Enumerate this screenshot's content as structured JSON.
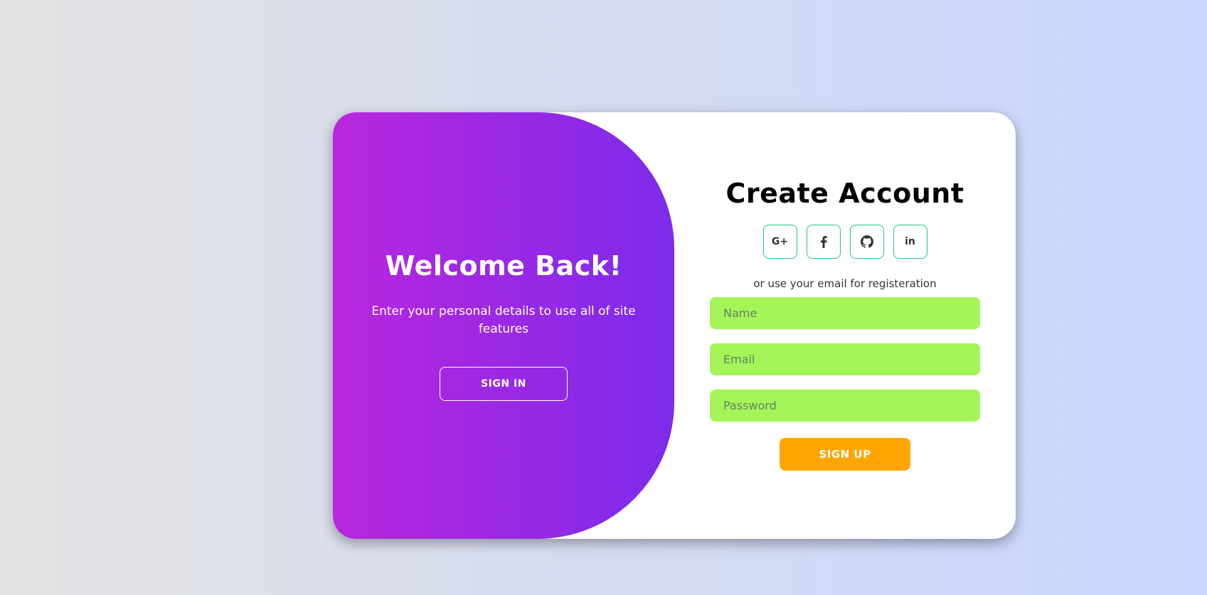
{
  "toggle": {
    "title": "Welcome Back!",
    "text": "Enter your personal details to use all of site features",
    "button_label": "SIGN IN"
  },
  "signup": {
    "title": "Create Account",
    "social": [
      {
        "icon": "google-plus-icon",
        "label": "G+"
      },
      {
        "icon": "facebook-icon",
        "label": "f"
      },
      {
        "icon": "github-icon",
        "label": ""
      },
      {
        "icon": "linkedin-icon",
        "label": "in"
      }
    ],
    "alt_text": "or use your email for registeration",
    "fields": {
      "name_placeholder": "Name",
      "email_placeholder": "Email",
      "password_placeholder": "Password"
    },
    "submit_label": "SIGN UP"
  },
  "colors": {
    "page_gradient_start": "#e2e2e2",
    "page_gradient_end": "#c9d6ff",
    "panel_gradient_start": "#b927dd",
    "panel_gradient_end": "#7c2bea",
    "input_background": "#a3f558",
    "social_border": "#22c77a",
    "signup_button": "#ffa500"
  }
}
